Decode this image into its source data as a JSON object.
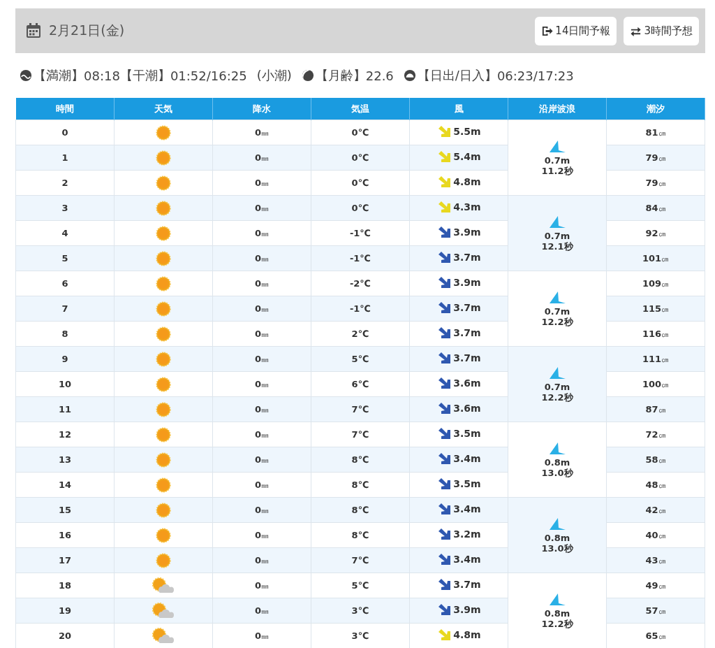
{
  "header": {
    "date": "2月21日(金)",
    "buttons": [
      "14日間予報",
      "3時間予想"
    ]
  },
  "tide_info": {
    "high_tide_label": "【満潮】",
    "high_tide": "08:18",
    "low_tide_label": "【干潮】",
    "low_tide": "01:52/16:25",
    "tide_type": "(小潮)",
    "moon_label": "【月齢】",
    "moon_age": "22.6",
    "sun_label": "【日出/日入】",
    "sun_times": "06:23/17:23"
  },
  "table": {
    "columns": [
      "時間",
      "天気",
      "降水",
      "気温",
      "風",
      "沿岸波浪",
      "潮汐"
    ],
    "rows": [
      {
        "hour": "0",
        "weather": {
          "kind": "sunny"
        },
        "rain": "0",
        "temp": "0℃",
        "wind": {
          "speed": "5.5m",
          "color": "#e8d820"
        },
        "tide": "81"
      },
      {
        "hour": "1",
        "weather": {
          "kind": "sunny"
        },
        "rain": "0",
        "temp": "0℃",
        "wind": {
          "speed": "5.4m",
          "color": "#e8d820"
        },
        "tide": "79"
      },
      {
        "hour": "2",
        "weather": {
          "kind": "sunny"
        },
        "rain": "0",
        "temp": "0℃",
        "wind": {
          "speed": "4.8m",
          "color": "#e8d820"
        },
        "tide": "79"
      },
      {
        "hour": "3",
        "weather": {
          "kind": "sunny"
        },
        "rain": "0",
        "temp": "0℃",
        "wind": {
          "speed": "4.3m",
          "color": "#e8d820"
        },
        "tide": "84"
      },
      {
        "hour": "4",
        "weather": {
          "kind": "sunny"
        },
        "rain": "0",
        "temp": "-1℃",
        "wind": {
          "speed": "3.9m",
          "color": "#2f58b0"
        },
        "tide": "92"
      },
      {
        "hour": "5",
        "weather": {
          "kind": "sunny"
        },
        "rain": "0",
        "temp": "-1℃",
        "wind": {
          "speed": "3.7m",
          "color": "#2f58b0"
        },
        "tide": "101"
      },
      {
        "hour": "6",
        "weather": {
          "kind": "sunny"
        },
        "rain": "0",
        "temp": "-2℃",
        "wind": {
          "speed": "3.9m",
          "color": "#2f58b0"
        },
        "tide": "109"
      },
      {
        "hour": "7",
        "weather": {
          "kind": "sunny"
        },
        "rain": "0",
        "temp": "-1℃",
        "wind": {
          "speed": "3.7m",
          "color": "#2f58b0"
        },
        "tide": "115"
      },
      {
        "hour": "8",
        "weather": {
          "kind": "sunny"
        },
        "rain": "0",
        "temp": "2℃",
        "wind": {
          "speed": "3.7m",
          "color": "#2f58b0"
        },
        "tide": "116"
      },
      {
        "hour": "9",
        "weather": {
          "kind": "sunny"
        },
        "rain": "0",
        "temp": "5℃",
        "wind": {
          "speed": "3.7m",
          "color": "#2f58b0"
        },
        "tide": "111"
      },
      {
        "hour": "10",
        "weather": {
          "kind": "sunny"
        },
        "rain": "0",
        "temp": "6℃",
        "wind": {
          "speed": "3.6m",
          "color": "#2f58b0"
        },
        "tide": "100"
      },
      {
        "hour": "11",
        "weather": {
          "kind": "sunny"
        },
        "rain": "0",
        "temp": "7℃",
        "wind": {
          "speed": "3.6m",
          "color": "#2f58b0"
        },
        "tide": "87"
      },
      {
        "hour": "12",
        "weather": {
          "kind": "sunny"
        },
        "rain": "0",
        "temp": "7℃",
        "wind": {
          "speed": "3.5m",
          "color": "#2f58b0"
        },
        "tide": "72"
      },
      {
        "hour": "13",
        "weather": {
          "kind": "sunny"
        },
        "rain": "0",
        "temp": "8℃",
        "wind": {
          "speed": "3.4m",
          "color": "#2f58b0"
        },
        "tide": "58"
      },
      {
        "hour": "14",
        "weather": {
          "kind": "sunny"
        },
        "rain": "0",
        "temp": "8℃",
        "wind": {
          "speed": "3.5m",
          "color": "#2f58b0"
        },
        "tide": "48"
      },
      {
        "hour": "15",
        "weather": {
          "kind": "sunny"
        },
        "rain": "0",
        "temp": "8℃",
        "wind": {
          "speed": "3.4m",
          "color": "#2f58b0"
        },
        "tide": "42"
      },
      {
        "hour": "16",
        "weather": {
          "kind": "sunny"
        },
        "rain": "0",
        "temp": "8℃",
        "wind": {
          "speed": "3.2m",
          "color": "#2f58b0"
        },
        "tide": "40"
      },
      {
        "hour": "17",
        "weather": {
          "kind": "sunny"
        },
        "rain": "0",
        "temp": "7℃",
        "wind": {
          "speed": "3.4m",
          "color": "#2f58b0"
        },
        "tide": "43"
      },
      {
        "hour": "18",
        "weather": {
          "kind": "sunny_cloudy"
        },
        "rain": "0",
        "temp": "5℃",
        "wind": {
          "speed": "3.7m",
          "color": "#2f58b0"
        },
        "tide": "49"
      },
      {
        "hour": "19",
        "weather": {
          "kind": "sunny_cloudy"
        },
        "rain": "0",
        "temp": "3℃",
        "wind": {
          "speed": "3.9m",
          "color": "#2f58b0"
        },
        "tide": "57"
      },
      {
        "hour": "20",
        "weather": {
          "kind": "sunny_cloudy"
        },
        "rain": "0",
        "temp": "3℃",
        "wind": {
          "speed": "4.8m",
          "color": "#e8d820"
        },
        "tide": "65"
      }
    ],
    "rain_unit": "㎜",
    "tide_unit": "㎝",
    "waves": [
      {
        "height": "0.7m",
        "period": "11.2秒"
      },
      {
        "height": "0.7m",
        "period": "12.1秒"
      },
      {
        "height": "0.7m",
        "period": "12.2秒"
      },
      {
        "height": "0.7m",
        "period": "12.2秒"
      },
      {
        "height": "0.8m",
        "period": "13.0秒"
      },
      {
        "height": "0.8m",
        "period": "13.0秒"
      },
      {
        "height": "0.8m",
        "period": "12.2秒"
      }
    ]
  }
}
